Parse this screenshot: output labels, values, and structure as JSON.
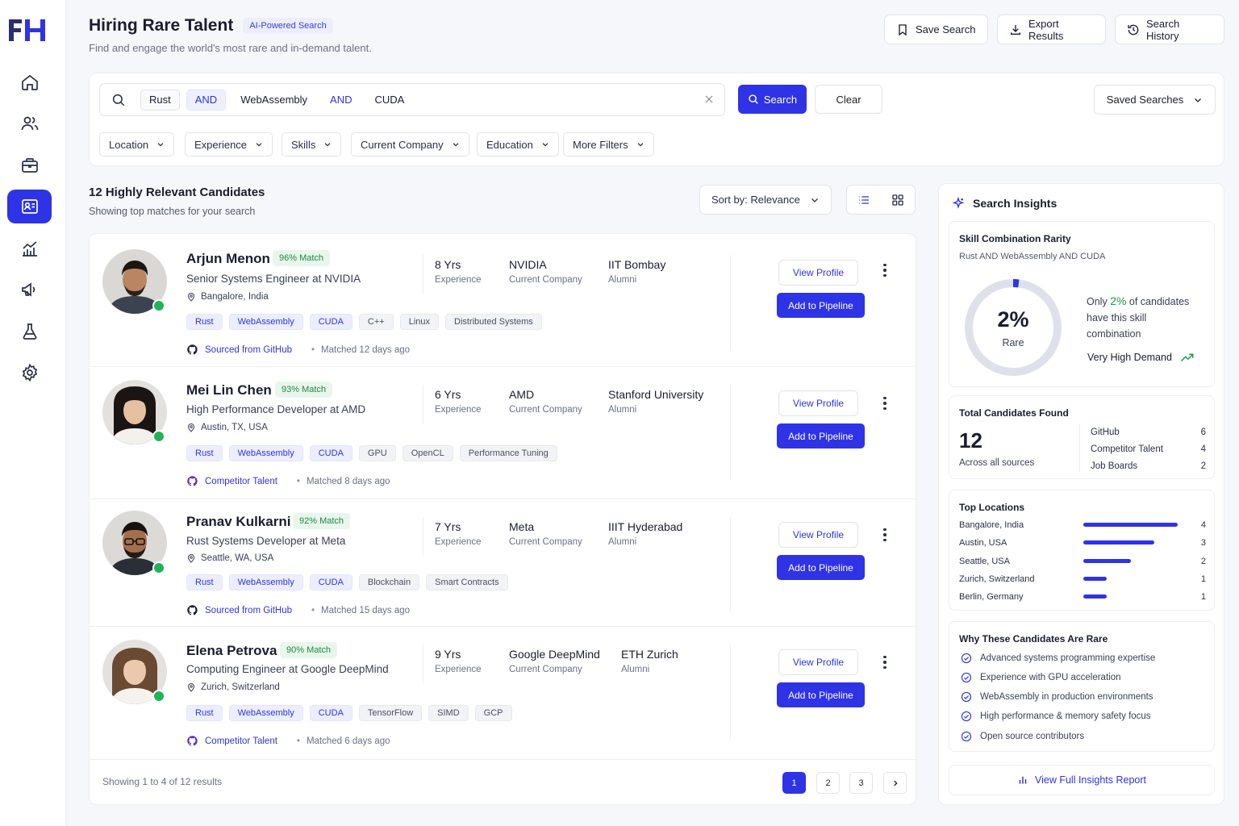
{
  "colors": {
    "accent": "#2e33e6",
    "match_green": "#1d8a44",
    "online": "#22b35a"
  },
  "header": {
    "title": "Hiring Rare Talent",
    "badge": "AI-Powered Search",
    "subtitle": "Find and engage the world's most rare and in-demand talent."
  },
  "top_actions": [
    {
      "label": "Save Search",
      "icon": "bookmark-icon"
    },
    {
      "label": "Export Results",
      "icon": "download-icon"
    },
    {
      "label": "Search History",
      "icon": "history-icon"
    }
  ],
  "sidebar": {
    "items": [
      {
        "icon": "home-icon",
        "active": false
      },
      {
        "icon": "users-icon",
        "active": false
      },
      {
        "icon": "briefcase-icon",
        "active": false
      },
      {
        "icon": "search-profile-icon",
        "active": true
      },
      {
        "icon": "analytics-icon",
        "active": false
      },
      {
        "icon": "megaphone-icon",
        "active": false
      },
      {
        "icon": "flask-icon",
        "active": false
      },
      {
        "icon": "settings-icon",
        "active": false
      }
    ]
  },
  "search": {
    "tokens": [
      "Rust",
      "AND",
      "WebAssembly",
      "AND",
      "CUDA"
    ],
    "search_label": "Search",
    "clear_label": "Clear",
    "saved_label": "Saved Searches"
  },
  "filters": [
    "Location",
    "Experience",
    "Skills",
    "Current Company",
    "Education",
    "More Filters"
  ],
  "results": {
    "title": "12  Highly Relevant Candidates",
    "subtitle": "Showing top matches for your search",
    "sort_label": "Sort by: Relevance"
  },
  "candidates": [
    {
      "name": "Arjun Menon",
      "match": "96% Match",
      "role": "Senior Systems Engineer at NVIDIA",
      "location": "Bangalore, India",
      "skills": [
        "Rust",
        "WebAssembly",
        "CUDA",
        "C++",
        "Linux",
        "Distributed Systems"
      ],
      "years": "8 Yrs",
      "years_label": "Experience",
      "company": "NVIDIA",
      "company_label": "Current Company",
      "school": "IIT Bombay",
      "school_label": "Alumni",
      "source": "Sourced from GitHub",
      "matched": "Matched 12 days ago",
      "view": "View Profile",
      "add": "Add to Pipeline"
    },
    {
      "name": "Mei Lin Chen",
      "match": "93% Match",
      "role": "High Performance Developer at AMD",
      "location": "Austin, TX, USA",
      "skills": [
        "Rust",
        "WebAssembly",
        "CUDA",
        "GPU",
        "OpenCL",
        "Performance Tuning"
      ],
      "years": "6 Yrs",
      "years_label": "Experience",
      "company": "AMD",
      "company_label": "Current Company",
      "school": "Stanford University",
      "school_label": "Alumni",
      "source": "Competitor Talent",
      "matched": "Matched 8 days ago",
      "view": "View Profile",
      "add": "Add to Pipeline"
    },
    {
      "name": "Pranav Kulkarni",
      "match": "92% Match",
      "role": "Rust Systems Developer at Meta",
      "location": "Seattle, WA, USA",
      "skills": [
        "Rust",
        "WebAssembly",
        "CUDA",
        "Blockchain",
        "Smart Contracts"
      ],
      "years": "7 Yrs",
      "years_label": "Experience",
      "company": "Meta",
      "company_label": "Current Company",
      "school": "IIIT Hyderabad",
      "school_label": "Alumni",
      "source": "Sourced from GitHub",
      "matched": "Matched 15 days ago",
      "view": "View Profile",
      "add": "Add to Pipeline"
    },
    {
      "name": "Elena Petrova",
      "match": "90% Match",
      "role": "Computing Engineer at Google DeepMind",
      "location": "Zurich, Switzerland",
      "skills": [
        "Rust",
        "WebAssembly",
        "CUDA",
        "TensorFlow",
        "SIMD",
        "GCP"
      ],
      "years": "9 Yrs",
      "years_label": "Experience",
      "company": "Google DeepMind",
      "company_label": "Current Company",
      "school": "ETH Zurich",
      "school_label": "Alumni",
      "source": "Competitor Talent",
      "matched": "Matched 6 days ago",
      "view": "View Profile",
      "add": "Add to Pipeline"
    }
  ],
  "pagination": {
    "summary": "Showing 1 to 4 of 12 results",
    "pages": [
      "1",
      "2",
      "3"
    ],
    "current": "1"
  },
  "insights": {
    "title": "Search Insights",
    "rarity": {
      "title": "Skill Combination Rarity",
      "query": "Rust AND WebAssembly AND CUDA",
      "value": "2%",
      "value_fraction": 0.02,
      "label": "Rare",
      "text_pre": "Only",
      "text_pct": "2%",
      "text_post": "of candidates",
      "text_line2": "have this skill",
      "text_line3": "combination",
      "demand": "Very High Demand"
    },
    "total": {
      "title": "Total Candidates Found",
      "count": "12",
      "count_label": "Across all sources",
      "sources": [
        {
          "name": "GitHub",
          "count": "6"
        },
        {
          "name": "Competitor Talent",
          "count": "4"
        },
        {
          "name": "Job Boards",
          "count": "2"
        }
      ]
    },
    "locations": {
      "title": "Top Locations",
      "items": [
        {
          "name": "Bangalore, India",
          "count": "4",
          "value": 4
        },
        {
          "name": "Austin, USA",
          "count": "3",
          "value": 3
        },
        {
          "name": "Seattle, USA",
          "count": "2",
          "value": 2
        },
        {
          "name": "Zurich, Switzerland",
          "count": "1",
          "value": 1
        },
        {
          "name": "Berlin, Germany",
          "count": "1",
          "value": 1
        }
      ]
    },
    "why": {
      "title": "Why These Candidates Are Rare",
      "items": [
        "Advanced systems programming expertise",
        "Experience with GPU acceleration",
        "WebAssembly in production environments",
        "High performance & memory safety focus",
        "Open source contributors"
      ]
    },
    "report_label": "View Full Insights Report"
  }
}
